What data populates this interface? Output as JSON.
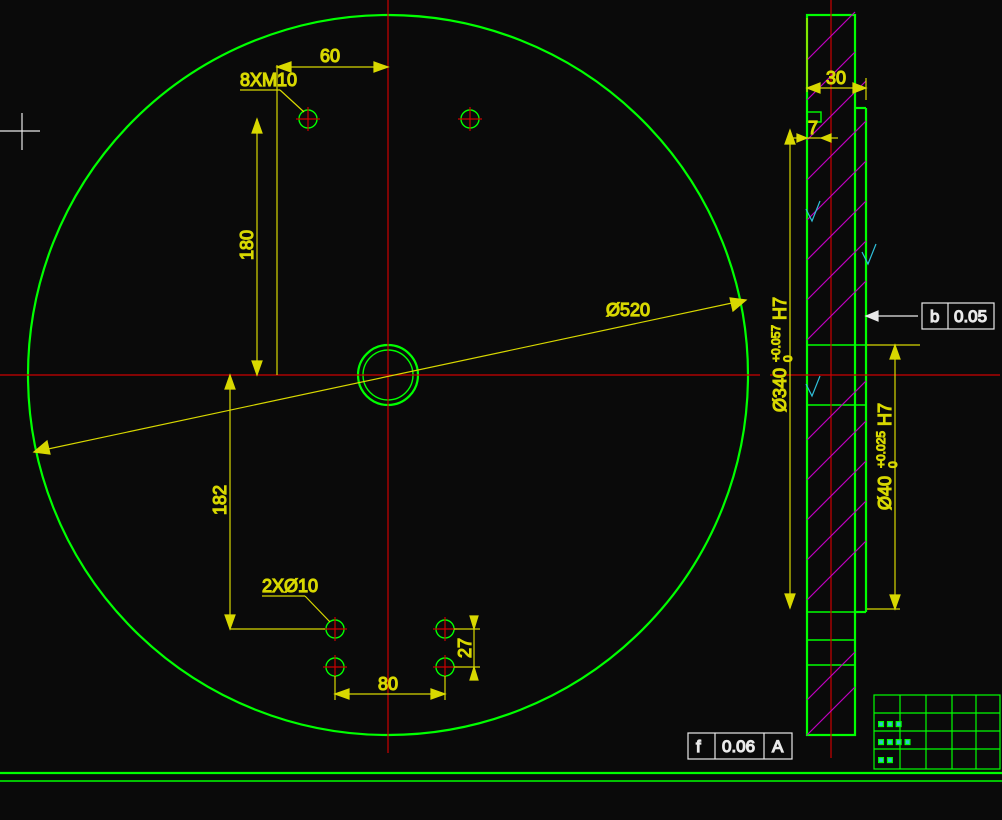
{
  "drawing": {
    "circle_diameter_label": "Ø520",
    "hole_callout_1": "8XM10",
    "hole_callout_2": "2XØ10",
    "dim_60": "60",
    "dim_180": "180",
    "dim_182": "182",
    "dim_80": "80",
    "dim_27": "27",
    "dim_30": "30",
    "dim_7": "7",
    "bore_dia_340": "Ø340",
    "bore_tol_340": "+0.057",
    "bore_tol_340_lo": "0",
    "bore_fit_340": "H7",
    "bore_dia_40": "Ø40",
    "bore_tol_40": "+0.025",
    "bore_tol_40_lo": "0",
    "bore_fit_40": "H7",
    "gtol_b_sym": "b",
    "gtol_b_val": "0.05",
    "gtol_f_sym": "f",
    "gtol_f_val": "0.06",
    "gtol_datum": "A"
  },
  "colors": {
    "geometry": "#00ff00",
    "centerline": "#cc0000",
    "dimension": "#d8d800",
    "hatch": "#c000c0",
    "frame": "#eaeaea"
  }
}
